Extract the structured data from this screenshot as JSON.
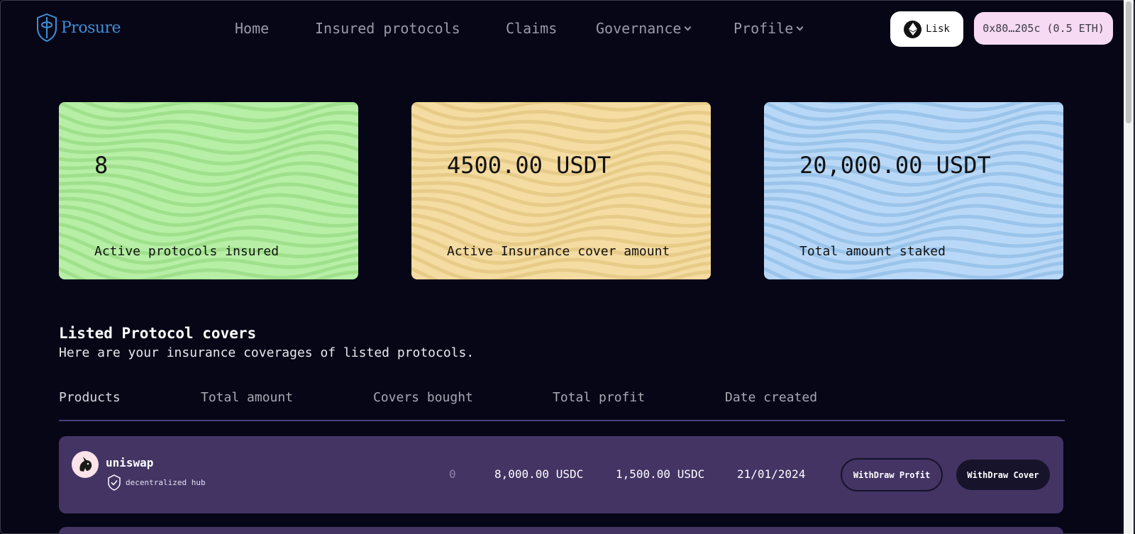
{
  "brand": {
    "name": "Prosure"
  },
  "nav": {
    "items": [
      {
        "label": "Home"
      },
      {
        "label": "Insured protocols"
      },
      {
        "label": "Claims"
      },
      {
        "label": "Governance"
      },
      {
        "label": "Profile"
      }
    ]
  },
  "network": {
    "label": "Lisk",
    "icon": "ethereum-icon"
  },
  "wallet": {
    "label": "0x80…205c (0.5 ETH)"
  },
  "stats": [
    {
      "value": "8",
      "label": "Active protocols insured",
      "color": "#b6efa5"
    },
    {
      "value": "4500.00 USDT",
      "label": "Active Insurance cover amount",
      "color": "#f4dca2"
    },
    {
      "value": "20,000.00 USDT",
      "label": "Total amount staked",
      "color": "#b9d8f7"
    }
  ],
  "section": {
    "title": "Listed Protocol covers",
    "subtitle": "Here are your insurance coverages of listed protocols."
  },
  "table": {
    "headers": [
      "Products",
      "Total amount",
      "Covers bought",
      "Total profit",
      "Date created"
    ],
    "rows": [
      {
        "name": "uniswap",
        "category": "decentralized hub",
        "icon": "uniswap-unicorn-icon",
        "covers": "0",
        "total_amount": "8,000.00 USDC",
        "total_profit": "1,500.00 USDC",
        "date": "21/01/2024",
        "withdraw_profit": "WithDraw Profit",
        "withdraw_cover": "WithDraw Cover"
      }
    ]
  },
  "colors": {
    "background": "#070617",
    "row": "#433464",
    "accent": "#3f8fd6",
    "wallet_bg": "#f6d9f2"
  }
}
